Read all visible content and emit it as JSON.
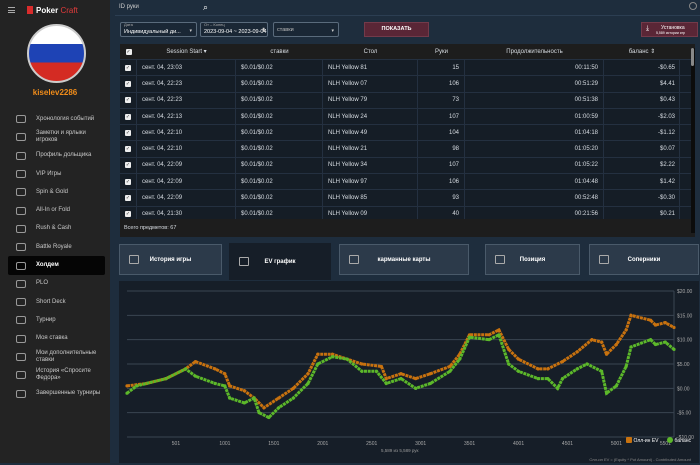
{
  "app": {
    "logo_a": "Poker",
    "logo_b": "Craft",
    "username": "kiselev2286"
  },
  "sidebar": {
    "items": [
      {
        "label": "Хронология событий"
      },
      {
        "label": "Заметки и ярлыки игроков"
      },
      {
        "label": "Профиль дольщика"
      },
      {
        "label": "VIP Игры"
      },
      {
        "label": "Spin & Gold"
      },
      {
        "label": "All-In or Fold"
      },
      {
        "label": "Rush & Cash"
      },
      {
        "label": "Battle Royale"
      },
      {
        "label": "Холдем",
        "active": true
      },
      {
        "label": "PLO"
      },
      {
        "label": "Short Deck"
      },
      {
        "label": "Турнир"
      },
      {
        "label": "Моя ставка"
      },
      {
        "label": "Мои дополнительные ставки"
      },
      {
        "label": "История «Спросите Федора»"
      },
      {
        "label": "Завершенные турниры"
      }
    ]
  },
  "topbar": {
    "hand_id_placeholder": "ID руки"
  },
  "filters": {
    "date_label": "Дата",
    "date_value": "Индивидуальный ди...",
    "range_label": "От – Конец",
    "range_value": "2023-09-04 ~ 2023-09-04",
    "stakes_value": "ставки",
    "show_button": "ПОКАЗАТЬ",
    "install_title": "Установка",
    "install_sub": "5,589 истории игр"
  },
  "table": {
    "headers": [
      "Session Start ▾",
      "ставки",
      "Стол",
      "Руки",
      "Продолжительность",
      "баланс ⇕"
    ],
    "rows": [
      [
        "сент. 04, 23:03",
        "$0.01/$0.02",
        "NLH Yellow 81",
        "15",
        "00:11:50",
        "-$0.65"
      ],
      [
        "сент. 04, 22:23",
        "$0.01/$0.02",
        "NLH Yellow 07",
        "106",
        "00:51:29",
        "$4.41"
      ],
      [
        "сент. 04, 22:23",
        "$0.01/$0.02",
        "NLH Yellow 79",
        "73",
        "00:51:38",
        "$0.43"
      ],
      [
        "сент. 04, 22:13",
        "$0.01/$0.02",
        "NLH Yellow 24",
        "107",
        "01:00:59",
        "-$2.03"
      ],
      [
        "сент. 04, 22:10",
        "$0.01/$0.02",
        "NLH Yellow 49",
        "104",
        "01:04:18",
        "-$1.12"
      ],
      [
        "сент. 04, 22:10",
        "$0.01/$0.02",
        "NLH Yellow 21",
        "98",
        "01:05:20",
        "$0.07"
      ],
      [
        "сент. 04, 22:09",
        "$0.01/$0.02",
        "NLH Yellow 34",
        "107",
        "01:05:22",
        "$2.22"
      ],
      [
        "сент. 04, 22:09",
        "$0.01/$0.02",
        "NLH Yellow 97",
        "106",
        "01:04:48",
        "$1.42"
      ],
      [
        "сент. 04, 22:09",
        "$0.01/$0.02",
        "NLH Yellow 85",
        "93",
        "00:52:48",
        "-$0.30"
      ],
      [
        "сент. 04, 21:30",
        "$0.01/$0.02",
        "NLH Yellow 09",
        "40",
        "00:21:56",
        "$0.21"
      ]
    ],
    "total": "Всего предметов: 67"
  },
  "tabs": [
    {
      "label": "История игры"
    },
    {
      "label": "EV график",
      "active": true
    },
    {
      "label": "карманные карты"
    },
    {
      "label": "Позиция"
    },
    {
      "label": "Соперники"
    }
  ],
  "chart_data": {
    "type": "line",
    "xlabel": "",
    "ylabel": "",
    "xlim": [
      1,
      5589
    ],
    "ylim": [
      -10,
      20
    ],
    "x_ticks": [
      "501",
      "1001",
      "1501",
      "2001",
      "2501",
      "3001",
      "3501",
      "4001",
      "4501",
      "5001",
      "5501"
    ],
    "y_ticks": [
      "$20.00",
      "$15.00",
      "$10.00",
      "$5.00",
      "$0.00",
      "-$5.00",
      "-$10.00"
    ],
    "series": [
      {
        "name": "Олл-ин EV",
        "color": "#c8720f",
        "points": [
          [
            1,
            0.5
          ],
          [
            200,
            1
          ],
          [
            400,
            2
          ],
          [
            600,
            4
          ],
          [
            700,
            5.5
          ],
          [
            900,
            4
          ],
          [
            1000,
            3
          ],
          [
            1050,
            0.5
          ],
          [
            1200,
            -0.5
          ],
          [
            1300,
            -2
          ],
          [
            1400,
            -4
          ],
          [
            1550,
            -2
          ],
          [
            1700,
            0
          ],
          [
            1850,
            3
          ],
          [
            1950,
            7
          ],
          [
            2100,
            7
          ],
          [
            2250,
            6
          ],
          [
            2400,
            5
          ],
          [
            2600,
            4.5
          ],
          [
            2650,
            2
          ],
          [
            2800,
            3
          ],
          [
            2950,
            2
          ],
          [
            3100,
            3
          ],
          [
            3300,
            4.5
          ],
          [
            3400,
            7
          ],
          [
            3500,
            11
          ],
          [
            3700,
            11
          ],
          [
            3800,
            12
          ],
          [
            3900,
            8
          ],
          [
            4000,
            6
          ],
          [
            4200,
            4
          ],
          [
            4300,
            4
          ],
          [
            4450,
            5.5
          ],
          [
            4600,
            7.5
          ],
          [
            4750,
            10
          ],
          [
            4850,
            9.5
          ],
          [
            4900,
            7
          ],
          [
            5000,
            9
          ],
          [
            5100,
            12
          ],
          [
            5150,
            15
          ],
          [
            5350,
            14
          ],
          [
            5400,
            13
          ],
          [
            5500,
            13.5
          ],
          [
            5589,
            12.5
          ]
        ]
      },
      {
        "name": "баланс",
        "color": "#5cb82a",
        "points": [
          [
            1,
            -1
          ],
          [
            100,
            0.5
          ],
          [
            400,
            2
          ],
          [
            600,
            4
          ],
          [
            700,
            2.5
          ],
          [
            900,
            1
          ],
          [
            1000,
            0.5
          ],
          [
            1050,
            -2
          ],
          [
            1200,
            -3
          ],
          [
            1300,
            -2
          ],
          [
            1350,
            -5
          ],
          [
            1450,
            -6
          ],
          [
            1550,
            -4
          ],
          [
            1700,
            -2
          ],
          [
            1850,
            1
          ],
          [
            1950,
            5
          ],
          [
            2100,
            6.5
          ],
          [
            2250,
            6
          ],
          [
            2400,
            3.5
          ],
          [
            2550,
            3.5
          ],
          [
            2650,
            1
          ],
          [
            2800,
            2
          ],
          [
            2950,
            0
          ],
          [
            3100,
            1
          ],
          [
            3300,
            3.5
          ],
          [
            3400,
            6
          ],
          [
            3500,
            10.5
          ],
          [
            3700,
            10
          ],
          [
            3800,
            11
          ],
          [
            3900,
            5
          ],
          [
            4000,
            3.5
          ],
          [
            4200,
            2
          ],
          [
            4300,
            2
          ],
          [
            4400,
            0
          ],
          [
            4450,
            2
          ],
          [
            4600,
            4
          ],
          [
            4700,
            5
          ],
          [
            4850,
            3.5
          ],
          [
            4900,
            -1
          ],
          [
            5000,
            0.5
          ],
          [
            5100,
            4.5
          ],
          [
            5150,
            8.5
          ],
          [
            5350,
            10
          ],
          [
            5400,
            9
          ],
          [
            5500,
            9.5
          ],
          [
            5589,
            8
          ]
        ]
      }
    ],
    "legend_position": "bottom-right",
    "hands_count": "5,589 из 5,589 рук",
    "formula": "Олл-ин EV = (Equity * Pot Amount) - Contributed Amount"
  }
}
